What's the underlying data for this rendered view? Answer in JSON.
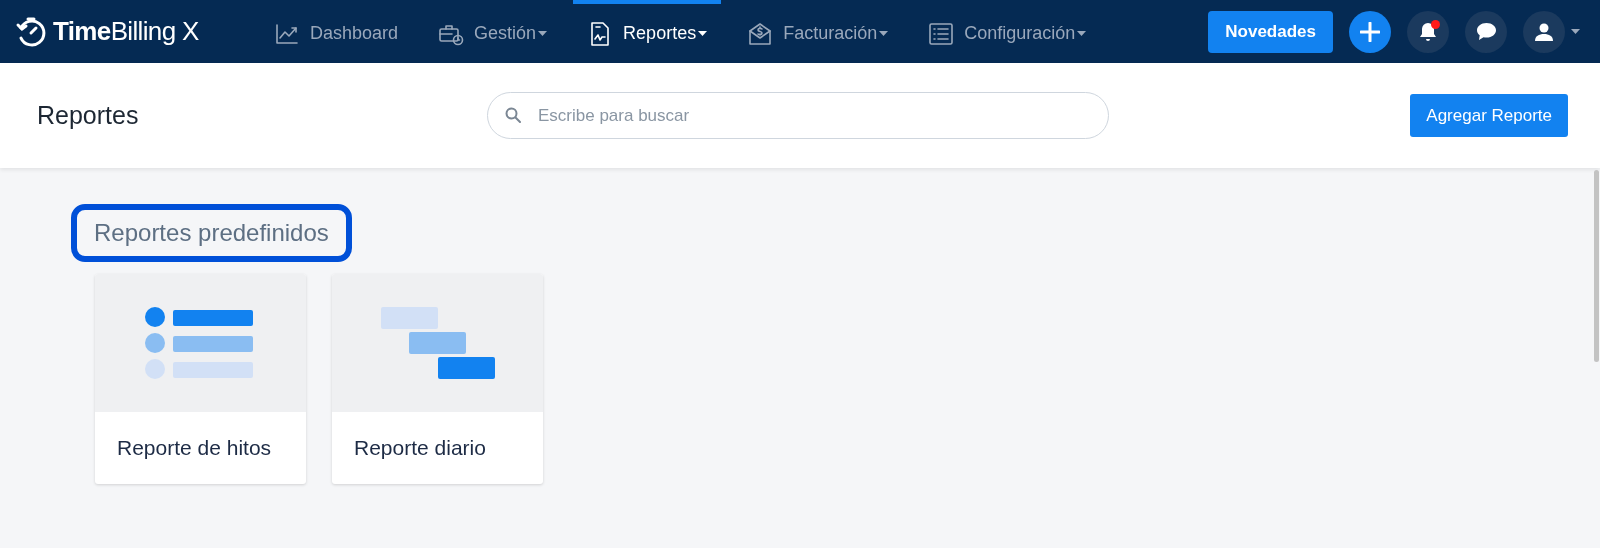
{
  "brand": {
    "name": "**Time**Billing X"
  },
  "nav": [
    {
      "kind": "chart",
      "label": "Dashboard",
      "selected": false,
      "dropdown": false
    },
    {
      "kind": "briefcase",
      "label": "Gestión",
      "selected": false,
      "dropdown": true
    },
    {
      "kind": "document",
      "label": "Reportes",
      "selected": true,
      "dropdown": true
    },
    {
      "kind": "money",
      "label": "Facturación",
      "selected": false,
      "dropdown": true
    },
    {
      "kind": "list",
      "label": "Configuración",
      "selected": false,
      "dropdown": true
    }
  ],
  "news_button": "Novedades",
  "notifications": {
    "unread": true
  },
  "page_header": {
    "title": "Reportes",
    "search": {
      "placeholder": "Escribe para buscar"
    },
    "add_button": "Agregar Reporte"
  },
  "section": {
    "title": "Reportes predefinidos",
    "highlighted": true
  },
  "cards": [
    {
      "kind": "list",
      "label": "Reporte de hitos"
    },
    {
      "kind": "gantt",
      "label": "Reporte diario"
    }
  ]
}
